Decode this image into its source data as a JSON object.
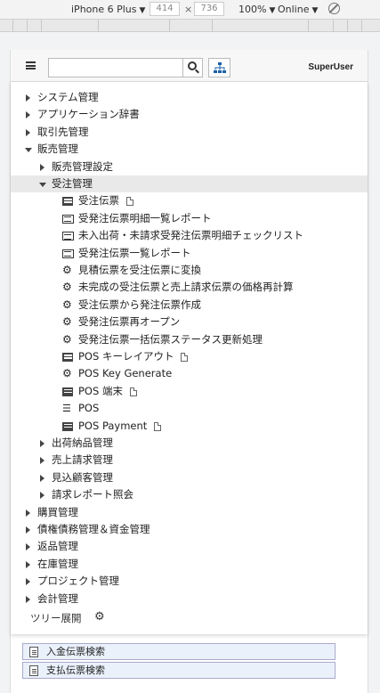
{
  "devtools": {
    "device": "iPhone 6 Plus",
    "width": "414",
    "times": "×",
    "height": "736",
    "zoom": "100%",
    "network": "Online"
  },
  "header": {
    "search_placeholder": "",
    "user": "SuperUser"
  },
  "tree": [
    {
      "label": "システム管理",
      "level": 0,
      "caret": "right"
    },
    {
      "label": "アプリケーション辞書",
      "level": 0,
      "caret": "right"
    },
    {
      "label": "取引先管理",
      "level": 0,
      "caret": "right"
    },
    {
      "label": "販売管理",
      "level": 0,
      "caret": "down"
    },
    {
      "label": "販売管理設定",
      "level": 1,
      "caret": "right"
    },
    {
      "label": "受注管理",
      "level": 1,
      "caret": "down",
      "selected": true
    },
    {
      "label": "受注伝票",
      "level": 2,
      "icon": "document-icon",
      "file": true
    },
    {
      "label": "受発注伝票明細一覧レポート",
      "level": 2,
      "icon": "report-icon"
    },
    {
      "label": "未入出荷・未請求受発注伝票明細チェックリスト",
      "level": 2,
      "icon": "report-icon"
    },
    {
      "label": "受発注伝票一覧レポート",
      "level": 2,
      "icon": "report-icon"
    },
    {
      "label": "見積伝票を受注伝票に変換",
      "level": 2,
      "icon": "gear-icon"
    },
    {
      "label": "未完成の受注伝票と売上請求伝票の価格再計算",
      "level": 2,
      "icon": "gear-icon"
    },
    {
      "label": "受注伝票から発注伝票作成",
      "level": 2,
      "icon": "gear-icon"
    },
    {
      "label": "受発注伝票再オープン",
      "level": 2,
      "icon": "gear-icon"
    },
    {
      "label": "受発注伝票一括伝票ステータス更新処理",
      "level": 2,
      "icon": "gear-icon"
    },
    {
      "label": "POS キーレイアウト",
      "level": 2,
      "icon": "document-icon",
      "file": true
    },
    {
      "label": "POS Key Generate",
      "level": 2,
      "icon": "gear-icon"
    },
    {
      "label": "POS 端末",
      "level": 2,
      "icon": "document-icon",
      "file": true
    },
    {
      "label": "POS",
      "level": 2,
      "icon": "list-icon"
    },
    {
      "label": "POS Payment",
      "level": 2,
      "icon": "document-icon",
      "file": true
    },
    {
      "label": "出荷納品管理",
      "level": 1,
      "caret": "right"
    },
    {
      "label": "売上請求管理",
      "level": 1,
      "caret": "right"
    },
    {
      "label": "見込顧客管理",
      "level": 1,
      "caret": "right"
    },
    {
      "label": "請求レポート照会",
      "level": 1,
      "caret": "right"
    },
    {
      "label": "購買管理",
      "level": 0,
      "caret": "right"
    },
    {
      "label": "債権債務管理＆資金管理",
      "level": 0,
      "caret": "right"
    },
    {
      "label": "返品管理",
      "level": 0,
      "caret": "right"
    },
    {
      "label": "在庫管理",
      "level": 0,
      "caret": "right"
    },
    {
      "label": "プロジェクト管理",
      "level": 0,
      "caret": "right"
    },
    {
      "label": "会計管理",
      "level": 0,
      "caret": "right"
    }
  ],
  "footer": {
    "expand_label": "ツリー展開"
  },
  "background_list": [
    {
      "label": "入金伝票検索"
    },
    {
      "label": "支払伝票検索"
    }
  ]
}
